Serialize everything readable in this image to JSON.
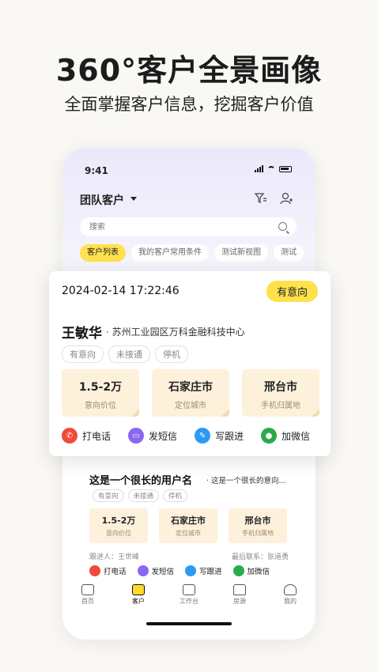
{
  "hero": {
    "title": "360°客户全景画像",
    "subtitle": "全面掌握客户信息，挖掘客户价值"
  },
  "status_bar": {
    "time": "9:41"
  },
  "header": {
    "title": "团队客户",
    "filter_icon": "filter-icon",
    "add_user_icon": "user-add-icon"
  },
  "search": {
    "placeholder": "搜索"
  },
  "views": [
    {
      "label": "客户列表",
      "active": true
    },
    {
      "label": "我的客户常用条件",
      "active": false
    },
    {
      "label": "测试新视图",
      "active": false
    },
    {
      "label": "测试",
      "active": false
    }
  ],
  "featured_card": {
    "time": "2024-02-14 17:22:46",
    "intent_badge": "有意向",
    "name": "王敏华",
    "company": "· 苏州工业园区万科金融科技中心",
    "tags": [
      "有意向",
      "未接通",
      "停机"
    ],
    "metrics": [
      {
        "value": "1.5-2万",
        "label": "意向价位"
      },
      {
        "value": "石家庄市",
        "label": "定位城市"
      },
      {
        "value": "邢台市",
        "label": "手机归属地"
      }
    ],
    "actions": [
      {
        "label": "打电话",
        "icon": "phone-icon",
        "color": "#f04a3a"
      },
      {
        "label": "发短信",
        "icon": "message-icon",
        "color": "#8a67f0"
      },
      {
        "label": "写跟进",
        "icon": "pen-icon",
        "color": "#2b9af3"
      },
      {
        "label": "加微信",
        "icon": "wechat-icon",
        "color": "#2aab4a"
      }
    ]
  },
  "list_card": {
    "name": "这是一个很长的用户名",
    "desc": "· 这是一个很长的意向...",
    "tags": [
      "有意向",
      "未接通",
      "停机"
    ],
    "metrics": [
      {
        "value": "1.5-2万",
        "label": "意向价位"
      },
      {
        "value": "石家庄市",
        "label": "定位城市"
      },
      {
        "value": "邢台市",
        "label": "手机归属地"
      }
    ],
    "follower": "跟进人：王世峰",
    "last_contact": "最后联系：张道勇",
    "actions": [
      {
        "label": "打电话",
        "color": "#f04a3a"
      },
      {
        "label": "发短信",
        "color": "#8a67f0"
      },
      {
        "label": "写跟进",
        "color": "#2b9af3"
      },
      {
        "label": "加微信",
        "color": "#2aab4a"
      }
    ]
  },
  "tabbar": [
    {
      "label": "首页",
      "icon": "message-square-icon",
      "active": false
    },
    {
      "label": "客户",
      "icon": "customer-card-icon",
      "active": true
    },
    {
      "label": "工作台",
      "icon": "desk-icon",
      "active": false
    },
    {
      "label": "房源",
      "icon": "house-icon",
      "active": false
    },
    {
      "label": "我的",
      "icon": "person-icon",
      "active": false
    }
  ]
}
